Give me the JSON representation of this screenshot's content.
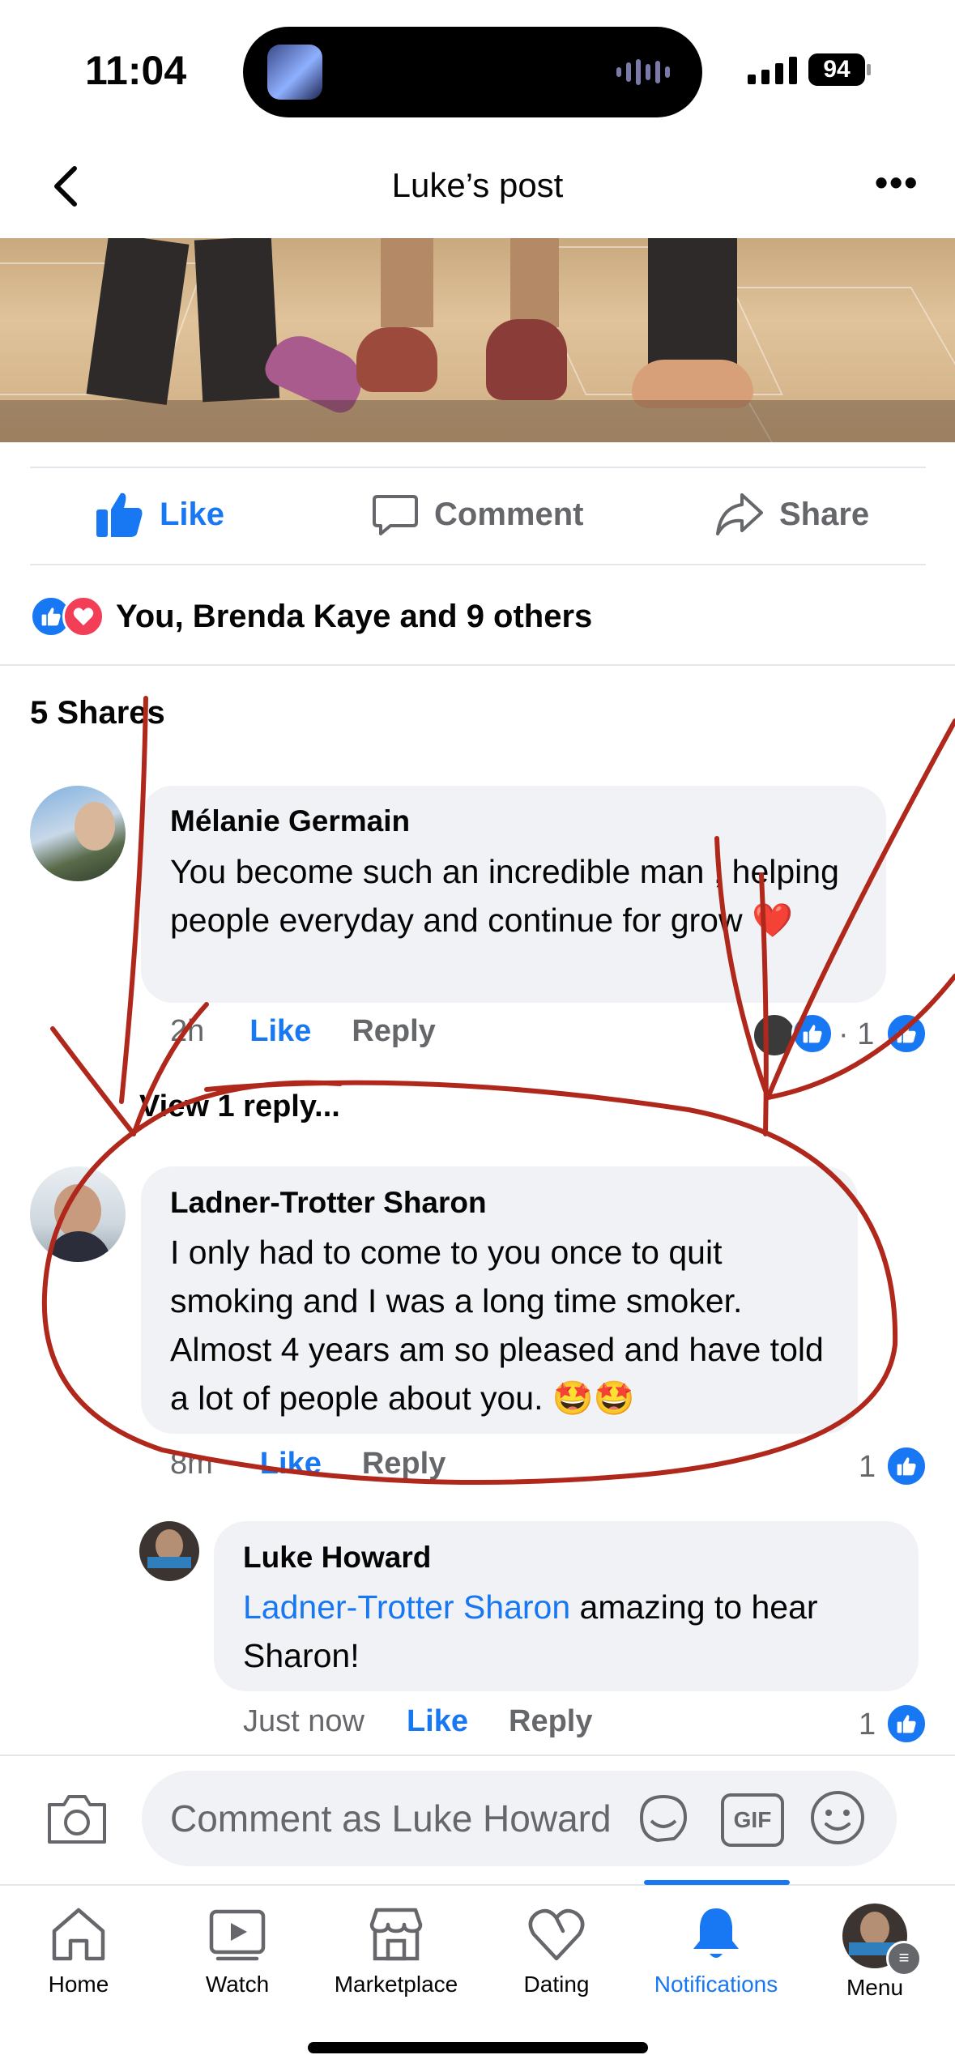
{
  "status_bar": {
    "time": "11:04",
    "battery": "94"
  },
  "header": {
    "title": "Luke’s post",
    "back_icon": "chevron-left-icon",
    "more_icon": "more-icon"
  },
  "actions": {
    "like": "Like",
    "comment": "Comment",
    "share": "Share"
  },
  "reactions": {
    "summary": "You, Brenda Kaye and 9 others"
  },
  "shares": "5 Shares",
  "comments": [
    {
      "author": "Mélanie Germain",
      "text": "You become such an incredible man , helping people everyday and continue for grow ❤️",
      "time": "2h",
      "like": "Like",
      "reply": "Reply",
      "reaction_count": "· 1",
      "view_replies": "View 1 reply..."
    },
    {
      "author": "Ladner-Trotter Sharon",
      "text": "I only had to come to you once to quit smoking and I was a long time smoker. Almost 4 years am so pleased and have told a lot of people about you. 🤩🤩",
      "time": "8m",
      "like": "Like",
      "reply": "Reply",
      "reaction_count": "1"
    }
  ],
  "reply": {
    "author": "Luke Howard",
    "mention": "Ladner-Trotter Sharon",
    "text_line1_rest": " amazing to hear",
    "text_line2": "Sharon!",
    "time": "Just now",
    "like": "Like",
    "reply": "Reply",
    "reaction_count": "1"
  },
  "composer": {
    "placeholder": "Comment as Luke Howard",
    "gif": "GIF"
  },
  "tabs": [
    {
      "label": "Home",
      "icon": "home-icon"
    },
    {
      "label": "Watch",
      "icon": "watch-icon"
    },
    {
      "label": "Marketplace",
      "icon": "marketplace-icon"
    },
    {
      "label": "Dating",
      "icon": "dating-icon"
    },
    {
      "label": "Notifications",
      "icon": "bell-icon",
      "active": true
    },
    {
      "label": "Menu",
      "icon": "avatar"
    }
  ],
  "colors": {
    "accent": "#1877f2",
    "bubble": "#f0f2f5",
    "secondary_text": "#65676b",
    "annotation": "#b0281c"
  }
}
